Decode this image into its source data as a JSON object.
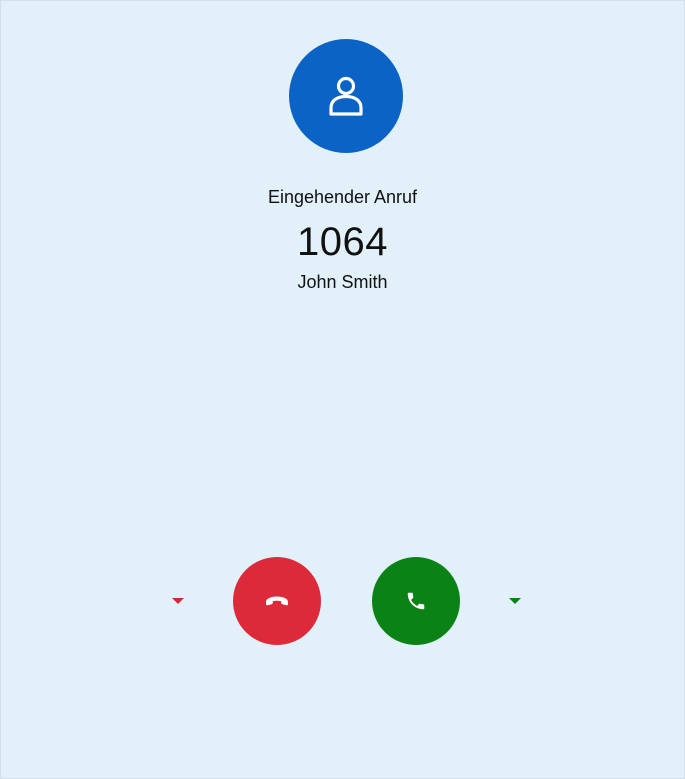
{
  "call": {
    "status_text": "Eingehender Anruf",
    "caller_number": "1064",
    "caller_name": "John Smith"
  },
  "icons": {
    "avatar": "person-icon",
    "decline": "phone-hangup-icon",
    "accept": "phone-icon",
    "decline_options": "caret-down-icon",
    "accept_options": "caret-down-icon"
  },
  "colors": {
    "background": "#e1f0f9",
    "avatar": "#0a63c5",
    "decline": "#dc2a3b",
    "accept": "#0b8216"
  }
}
